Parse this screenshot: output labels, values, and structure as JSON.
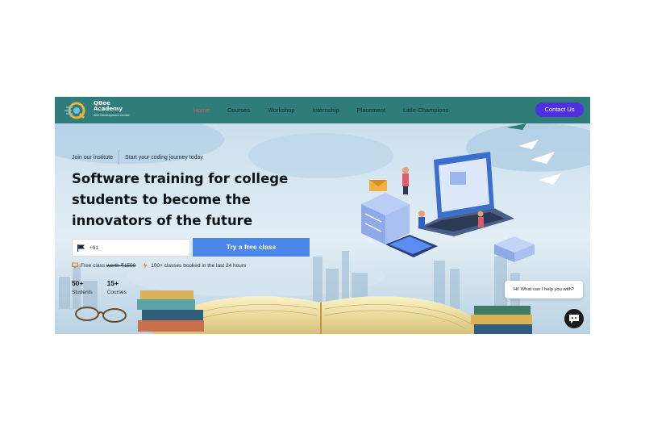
{
  "brand": {
    "name": "QBee Academy",
    "subtitle": "Skill Development Center",
    "accent": "#2e7d7a",
    "button_color": "#4f2fe0"
  },
  "nav": {
    "items": [
      {
        "label": "Home",
        "active": true
      },
      {
        "label": "Courses",
        "active": false
      },
      {
        "label": "Workshop",
        "active": false
      },
      {
        "label": "Internship",
        "active": false
      },
      {
        "label": "Placement",
        "active": false
      },
      {
        "label": "Little-Champions",
        "active": false
      }
    ],
    "contact_label": "Contact Us"
  },
  "hero": {
    "tag_left": "Join our institute",
    "tag_right": "Start your coding journey today",
    "headline": "Software training for college students to become the innovators of the future",
    "phone_code": "+91",
    "cta_label": "Try a free class",
    "cta_color": "#4d86ea",
    "offer_text": "Free class",
    "offer_worth": "worth ₹1500",
    "booked_text": "100+ classes booked in the last 24 hours",
    "stats": [
      {
        "value": "50+",
        "label": "Students"
      },
      {
        "value": "15+",
        "label": "Courses"
      }
    ]
  },
  "chat": {
    "bubble_text": "Hi! What can I help you with?",
    "icon": "chat-icon"
  }
}
